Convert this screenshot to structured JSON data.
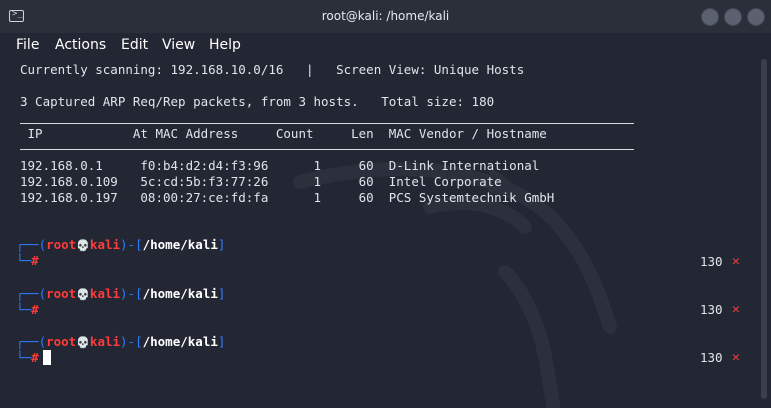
{
  "window": {
    "title": "root@kali: /home/kali"
  },
  "menu": [
    "File",
    "Actions",
    "Edit",
    "View",
    "Help"
  ],
  "scan": {
    "status_line": "Currently scanning: 192.168.10.0/16   |   Screen View: Unique Hosts",
    "summary_line": "3 Captured ARP Req/Rep packets, from 3 hosts.   Total size: 180",
    "header_line": " IP            At MAC Address     Count     Len  MAC Vendor / Hostname",
    "rows": [
      "192.168.0.1     f0:b4:d2:d4:f3:96      1     60  D-Link International",
      "192.168.0.109   5c:cd:5b:f3:77:26      1     60  Intel Corporate",
      "192.168.0.197   08:00:27:ce:fd:fa      1     60  PCS Systemtechnik GmbH"
    ]
  },
  "prompt": {
    "open": "┌──(",
    "user": "root",
    "skull": "💀",
    "host": "kali",
    "mid": ")-[",
    "path": "/home/kali",
    "close": "]",
    "second_open": "└─",
    "hash": "#"
  },
  "prompts": [
    {
      "exit_code": "130",
      "exit_icon": "x-mark-icon"
    },
    {
      "exit_code": "130",
      "exit_icon": "x-mark-icon"
    },
    {
      "exit_code": "130",
      "exit_icon": "x-mark-icon"
    }
  ],
  "colors": {
    "prompt_blue": "#2f7bff",
    "prompt_red": "#ff3b3b",
    "background": "#232733"
  }
}
